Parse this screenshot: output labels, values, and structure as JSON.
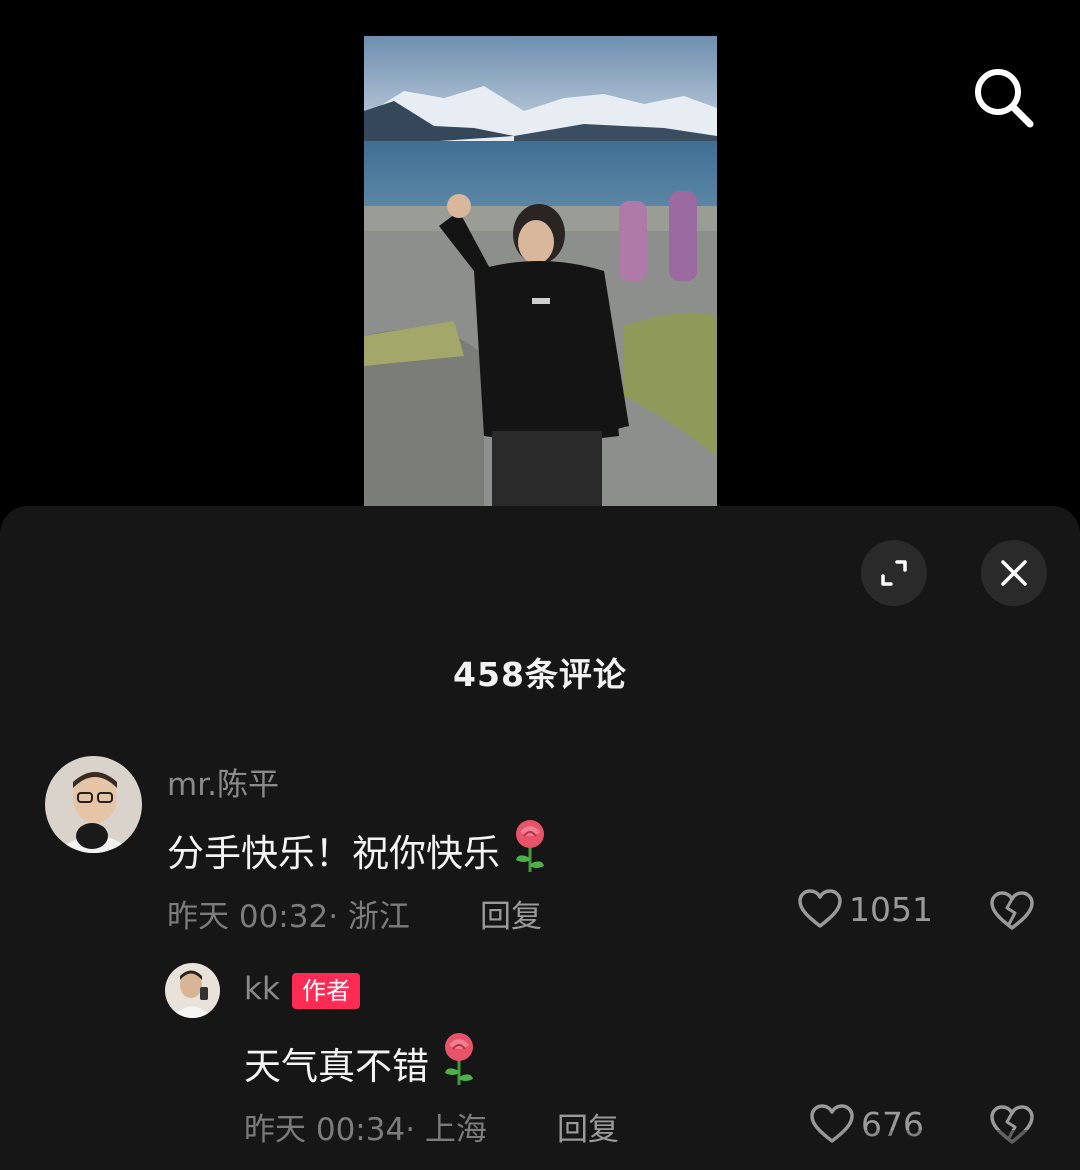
{
  "comments_sheet": {
    "title": "458条评论"
  },
  "comments": [
    {
      "username": "mr.陈平",
      "text": "分手快乐！祝你快乐",
      "time": "昨天 00:32",
      "location": "· 浙江",
      "reply_label": "回复",
      "likes": "1051"
    }
  ],
  "replies": [
    {
      "username": "kk",
      "badge": "作者",
      "text": "天气真不错",
      "time": "昨天 00:34",
      "location": "· 上海",
      "reply_label": "回复",
      "likes": "676"
    }
  ],
  "colors": {
    "sheet_background": "#161616",
    "author_badge": "#fe2c55",
    "secondary_text": "#8a8a8a"
  },
  "icons": [
    "search-icon",
    "expand-icon",
    "close-icon",
    "heart-icon",
    "broken-heart-icon",
    "rose-emoji"
  ]
}
